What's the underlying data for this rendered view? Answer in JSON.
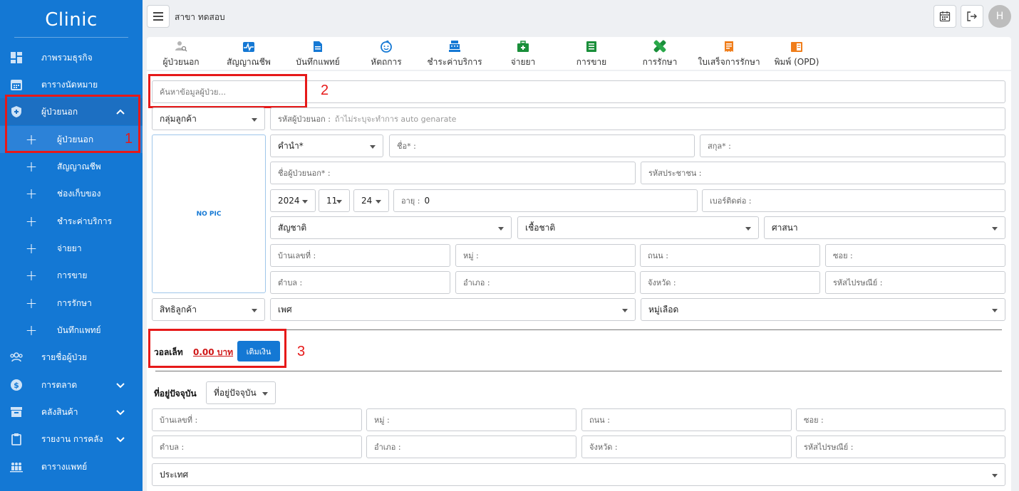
{
  "app": {
    "title": "Clinic",
    "branch": "สาขา ทดสอบ",
    "avatar_initial": "H"
  },
  "sidebar": {
    "items": [
      {
        "label": "ภาพรวมธุรกิจ",
        "icon": "dashboard-icon"
      },
      {
        "label": "ตารางนัดหมาย",
        "icon": "calendar-icon"
      },
      {
        "label": "ผู้ป่วยนอก",
        "icon": "shield-icon",
        "expanded": true
      },
      {
        "label": "ผู้ป่วยนอก",
        "icon": "plus-icon"
      },
      {
        "label": "สัญญาณชีพ",
        "icon": "plus-icon"
      },
      {
        "label": "ช่องเก็บของ",
        "icon": "plus-icon"
      },
      {
        "label": "ชำระค่าบริการ",
        "icon": "plus-icon"
      },
      {
        "label": "จ่ายยา",
        "icon": "plus-icon"
      },
      {
        "label": "การขาย",
        "icon": "plus-icon"
      },
      {
        "label": "การรักษา",
        "icon": "plus-icon"
      },
      {
        "label": "บันทึกแพทย์",
        "icon": "plus-icon"
      },
      {
        "label": "รายชื่อผู้ป่วย",
        "icon": "group-icon"
      },
      {
        "label": "การตลาด",
        "icon": "dollar-icon"
      },
      {
        "label": "คลังสินค้า",
        "icon": "archive-icon"
      },
      {
        "label": "รายงาน การคลัง",
        "icon": "clipboard-icon"
      },
      {
        "label": "ตารางแพทย์",
        "icon": "people-icon"
      }
    ]
  },
  "annotations": {
    "n1": "1",
    "n2": "2",
    "n3": "3"
  },
  "toolbar": {
    "tabs": [
      {
        "label": "ผู้ป่วยนอก",
        "icon": "person-search-icon"
      },
      {
        "label": "สัญญาณชีพ",
        "icon": "vital-sign-icon"
      },
      {
        "label": "บันทึกแพทย์",
        "icon": "document-icon"
      },
      {
        "label": "หัตถการ",
        "icon": "baby-face-icon"
      },
      {
        "label": "ชำระค่าบริการ",
        "icon": "cash-register-icon"
      },
      {
        "label": "จ่ายยา",
        "icon": "medical-bag-icon"
      },
      {
        "label": "การขาย",
        "icon": "list-icon"
      },
      {
        "label": "การรักษา",
        "icon": "bandage-icon"
      },
      {
        "label": "ใบเสร็จการรักษา",
        "icon": "receipt-icon"
      },
      {
        "label": "พิมพ์ (OPD)",
        "icon": "book-icon"
      }
    ]
  },
  "form": {
    "search_placeholder": "ค้นหาข้อมูลผู้ป่วย...",
    "customer_group": "กลุ่มลูกค้า",
    "patient_code_label": "รหัสผู้ป่วยนอก :",
    "patient_code_hint": "ถ้าไม่ระบุจะทำการ auto genarate",
    "photo_text": "NO PIC",
    "prefix": "คำนำ*",
    "first_name": "ชื่อ* :",
    "last_name": "สกุล* :",
    "outpatient_name": "ชื่อผู้ป่วยนอก* :",
    "citizen_id": "รหัสประชาชน :",
    "birth_year": "2024",
    "birth_month": "11",
    "birth_day": "24",
    "age_label": "อายุ :",
    "age_value": "0",
    "phone": "เบอร์ติดต่อ :",
    "nationality": "สัญชาติ",
    "race": "เชื้อชาติ",
    "religion": "ศาสนา",
    "house_no": "บ้านเลขที่ :",
    "moo": "หมู่ :",
    "road": "ถนน :",
    "soi": "ซอย :",
    "subdistrict": "ตำบล :",
    "district": "อำเภอ :",
    "province": "จังหวัด :",
    "postcode": "รหัสไปรษณีย์ :",
    "customer_right": "สิทธิลูกค้า",
    "gender": "เพศ",
    "blood_group": "หมู่เลือด"
  },
  "wallet": {
    "label": "วอลเล็ท",
    "amount": "0.00 บาท",
    "topup_button": "เติมเงิน"
  },
  "current_address": {
    "title": "ที่อยู่ปัจจุบัน",
    "type_select": "ที่อยู่ปัจจุบัน",
    "house_no": "บ้านเลขที่ :",
    "moo": "หมู่ :",
    "road": "ถนน :",
    "soi": "ซอย :",
    "subdistrict": "ตำบล :",
    "district": "อำเภอ :",
    "province": "จังหวัด :",
    "postcode": "รหัสไปรษณีย์ :",
    "country": "ประเทศ"
  },
  "colors": {
    "sidebar": "#1478d4",
    "annotation": "#e61919",
    "wallet_amount": "#d01717"
  }
}
